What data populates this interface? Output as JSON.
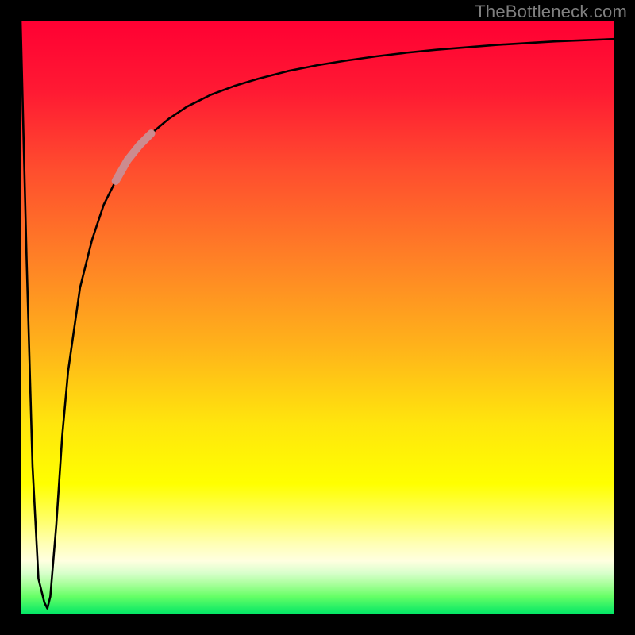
{
  "watermark": "TheBottleneck.com",
  "chart_data": {
    "type": "line",
    "title": "",
    "xlabel": "",
    "ylabel": "",
    "xlim": [
      0,
      100
    ],
    "ylim": [
      0,
      100
    ],
    "series": [
      {
        "name": "bottleneck-curve",
        "x": [
          0,
          1,
          2,
          3,
          4,
          4.5,
          5,
          6,
          7,
          8,
          10,
          12,
          14,
          16,
          18,
          20,
          22,
          25,
          28,
          32,
          36,
          40,
          45,
          50,
          55,
          60,
          65,
          70,
          75,
          80,
          85,
          90,
          95,
          100
        ],
        "y": [
          100,
          60,
          25,
          6,
          2,
          1,
          3,
          15,
          30,
          41,
          55,
          63,
          69,
          73,
          76.5,
          79,
          81,
          83.5,
          85.5,
          87.5,
          89,
          90.2,
          91.5,
          92.5,
          93.3,
          94,
          94.6,
          95.1,
          95.5,
          95.9,
          96.2,
          96.5,
          96.7,
          96.9
        ]
      }
    ],
    "highlight_segment": {
      "series": "bottleneck-curve",
      "x_start": 16,
      "x_end": 22,
      "color": "#cc8b8f"
    },
    "background": {
      "type": "vertical-gradient",
      "stops": [
        {
          "pos": 0.0,
          "color": "#ff0033"
        },
        {
          "pos": 0.25,
          "color": "#ff4d2e"
        },
        {
          "pos": 0.55,
          "color": "#ffb31a"
        },
        {
          "pos": 0.78,
          "color": "#ffff00"
        },
        {
          "pos": 0.91,
          "color": "#ffffe0"
        },
        {
          "pos": 1.0,
          "color": "#00e666"
        }
      ]
    }
  }
}
